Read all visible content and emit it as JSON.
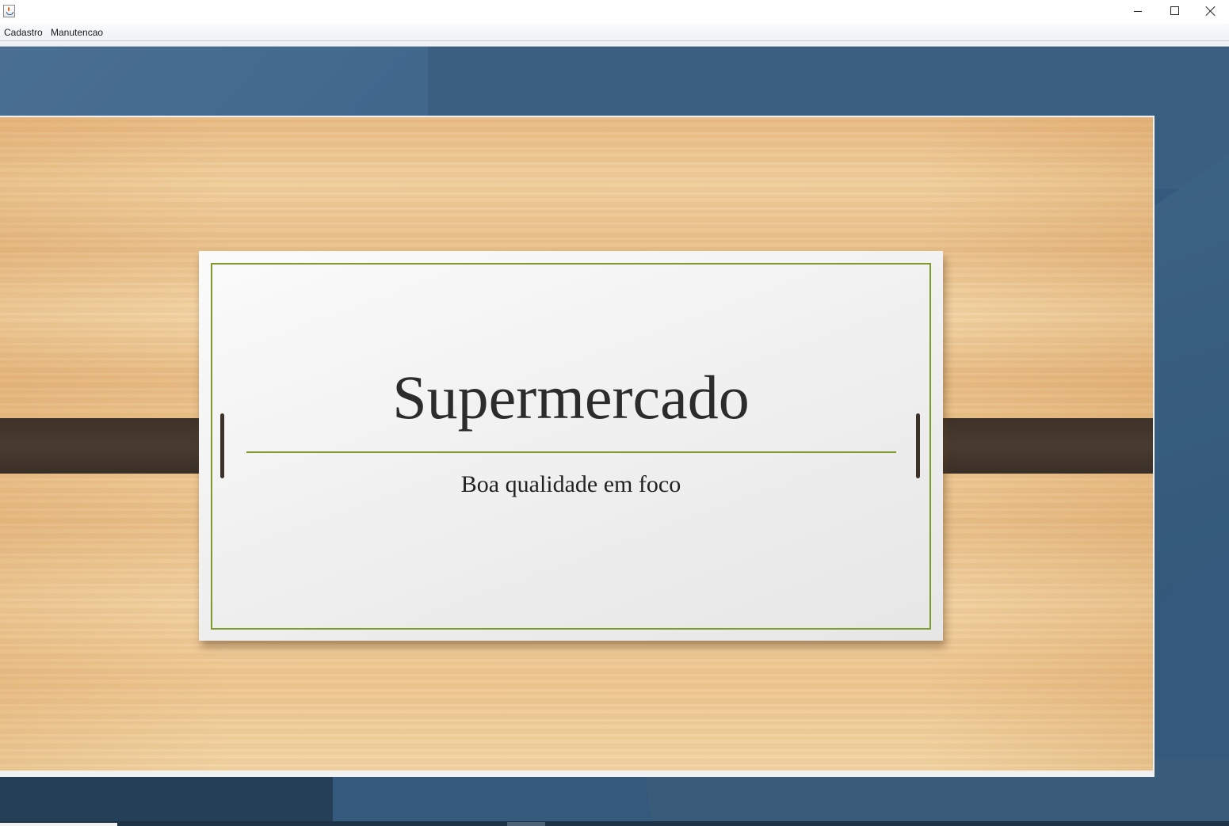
{
  "window": {
    "title": ""
  },
  "menubar": {
    "items": [
      {
        "label": "Cadastro"
      },
      {
        "label": "Manutencao"
      }
    ]
  },
  "slide": {
    "title": "Supermercado",
    "subtitle": "Boa qualidade em foco"
  },
  "colors": {
    "desktop": "#35597c",
    "accent_green": "#7f9a2c",
    "strap": "#3d3229",
    "wood": "#f0cf9c"
  },
  "icons": [
    "java-app-icon",
    "minimize-icon",
    "maximize-icon",
    "close-icon"
  ]
}
